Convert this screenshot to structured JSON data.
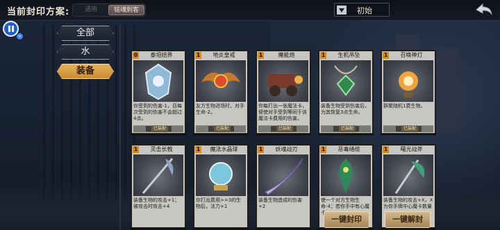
{
  "header": {
    "seal_label": "当前封印方案:",
    "seal_options": {
      "general": "通用",
      "selected": "铭魂刺客"
    },
    "preset_value": "初始"
  },
  "categories": [
    {
      "label": "全部"
    },
    {
      "label": "水"
    },
    {
      "label": "装备"
    }
  ],
  "cards": [
    {
      "cost": "0",
      "name": "泰坦结界",
      "desc": "你受到的伤害-1，且每次受到的伤害不会超过4点。",
      "tag": "已装配",
      "art_color": "#7fb6d8"
    },
    {
      "cost": "1",
      "name": "地炎皇戒",
      "desc": "友方生物进场时，对手生命-2。",
      "tag": "已装配",
      "art_color": "#d4662c"
    },
    {
      "cost": "1",
      "name": "魔能炮",
      "desc": "你每打出一张魔法卡，便使对手受到等同于该魔法卡费用的伤害。",
      "tag": "已装配",
      "art_color": "#8a3b2a"
    },
    {
      "cost": "1",
      "name": "生机吊坠",
      "desc": "装备生物受到伤害后，为其恢复3点生命。",
      "tag": "已装配",
      "art_color": "#3f9a52"
    },
    {
      "cost": "1",
      "name": "召唤神灯",
      "desc": "群聚随机1费生物。",
      "tag": "已装配",
      "art_color": "#e0a23a"
    },
    {
      "cost": "1",
      "name": "灵击长戟",
      "desc": "装备生物的攻击+1；被攻击时攻击+4",
      "tag": "",
      "art_color": "#5a6e9a"
    },
    {
      "cost": "1",
      "name": "魔法水晶球",
      "desc": "你打出费用>=3的生物后，法力+1",
      "tag": "",
      "art_color": "#6fc0d8"
    },
    {
      "cost": "1",
      "name": "妖魂战刃",
      "desc": "装备生物造成的伤害+2",
      "tag": "",
      "art_color": "#8a6fb8"
    },
    {
      "cost": "1",
      "name": "恶毒绪缆",
      "desc": "使一个对方生物生命-4；若你手中有心魔卡",
      "tag": "",
      "art_color": "#3aa06a"
    },
    {
      "cost": "1",
      "name": "曙光战斧",
      "desc": "装备生物的攻击+X，X为你手牌中心魔卡数量",
      "tag": "",
      "art_color": "#4aa07a"
    }
  ],
  "buttons": {
    "seal_all": "一键封印",
    "unseal_all": "一键解封"
  }
}
